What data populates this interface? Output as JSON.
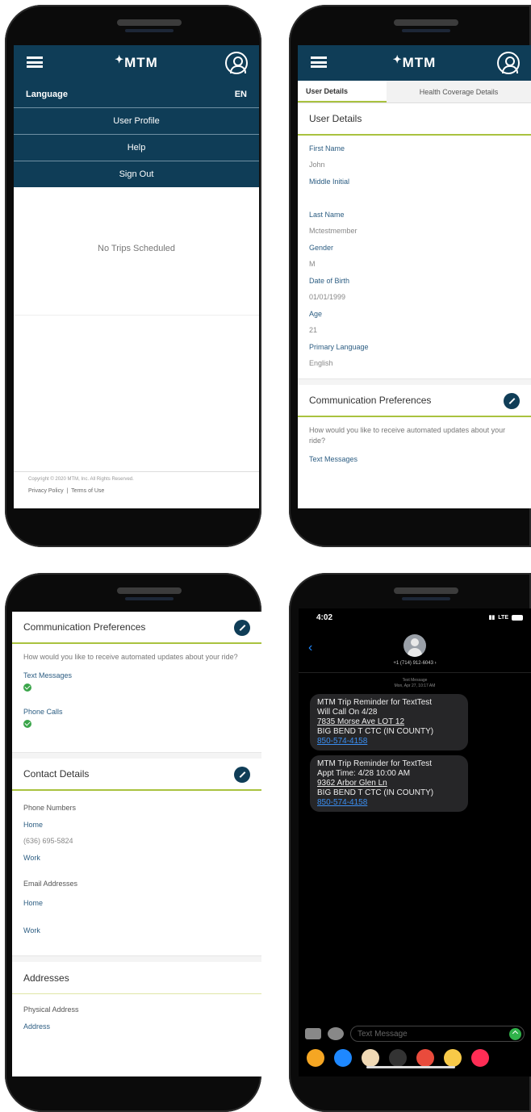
{
  "s1": {
    "logo": "MTM",
    "language_label": "Language",
    "language_value": "EN",
    "menu": [
      "User Profile",
      "Help",
      "Sign Out"
    ],
    "empty_state": "No Trips Scheduled",
    "copyright": "Copyright © 2020 MTM, Inc. All Rights Reserved.",
    "privacy": "Privacy Policy",
    "terms": "Terms of Use"
  },
  "s2": {
    "logo": "MTM",
    "tabs": [
      "User Details",
      "Health Coverage Details"
    ],
    "section_title": "User Details",
    "fields": [
      {
        "label": "First Name",
        "value": "John"
      },
      {
        "label": "Middle Initial",
        "value": ""
      },
      {
        "label": "Last Name",
        "value": "Mctestmember"
      },
      {
        "label": "Gender",
        "value": "M"
      },
      {
        "label": "Date of Birth",
        "value": "01/01/1999"
      },
      {
        "label": "Age",
        "value": "21"
      },
      {
        "label": "Primary Language",
        "value": "English"
      }
    ],
    "comm_title": "Communication Preferences",
    "comm_question": "How would you like to receive automated updates about your ride?",
    "comm_partial": "Text Messages"
  },
  "s3": {
    "comm_title": "Communication Preferences",
    "comm_question": "How would you like to receive automated updates about your ride?",
    "text_messages": "Text Messages",
    "phone_calls": "Phone Calls",
    "contact_title": "Contact Details",
    "phone_numbers": "Phone Numbers",
    "home": "Home",
    "home_phone": "(636) 695-5824",
    "work": "Work",
    "email_addresses": "Email Addresses",
    "email_home": "Home",
    "email_work": "Work",
    "addresses_title": "Addresses",
    "physical_address": "Physical Address",
    "address_label": "Address"
  },
  "s4": {
    "time": "4:02",
    "network": "LTE",
    "contact_number": "+1 (714) 912-6043 ›",
    "msg_kind": "Text Message",
    "msg_date": "Mon, Apr 27, 10:17 AM",
    "msg1": [
      "MTM Trip Reminder for TextTest",
      "Will Call On 4/28",
      "7835 Morse Ave LOT 12",
      "BIG BEND T CTC (IN COUNTY)",
      "850-574-4158"
    ],
    "msg2": [
      "MTM Trip Reminder for TextTest",
      "Appt Time: 4/28 10:00 AM",
      "9362 Arbor Glen Ln",
      "BIG BEND T CTC (IN COUNTY)",
      "850-574-4158"
    ],
    "composer_placeholder": "Text Message",
    "app_colors": [
      "#f5a623",
      "#1e88ff",
      "#f0d9b5",
      "#333333",
      "#e94b3c",
      "#f7c948",
      "#ff2d55",
      "#888888"
    ]
  }
}
